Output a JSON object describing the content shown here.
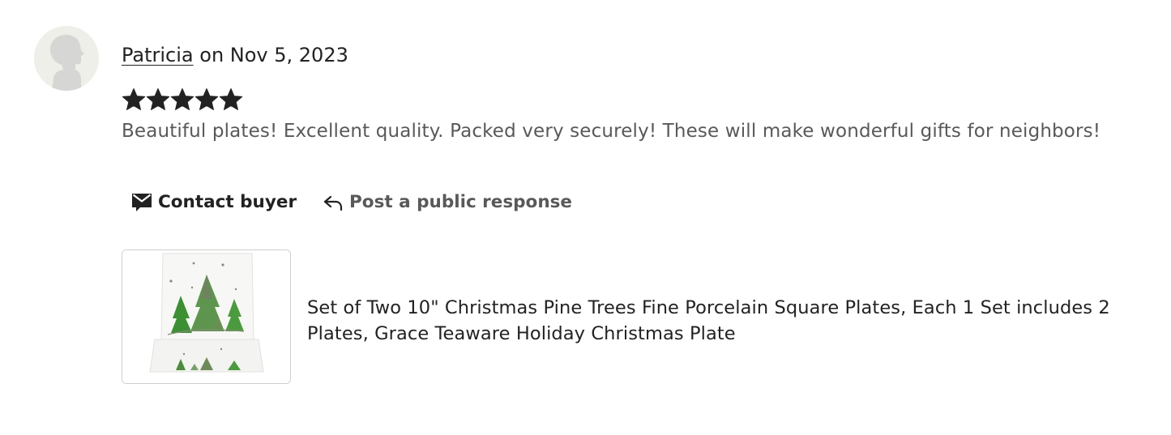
{
  "review": {
    "reviewer_name": "Patricia",
    "date_text": "on Nov 5, 2023",
    "rating": 5,
    "rating_max": 5,
    "body": "Beautiful plates! Excellent quality. Packed very securely! These will make wonderful gifts for neighbors!"
  },
  "actions": {
    "contact_label": "Contact buyer",
    "contact_icon": "envelope-icon",
    "respond_label": "Post a public response",
    "respond_icon": "reply-arrow-icon"
  },
  "listing": {
    "title": "Set of Two 10\" Christmas Pine Trees Fine Porcelain Square Plates, Each 1 Set includes 2 Plates, Grace Teaware Holiday Christmas Plate",
    "thumbnail_icon": "christmas-tree-plate-image"
  },
  "colors": {
    "text_primary": "#222222",
    "text_secondary": "#595959",
    "avatar_bg": "#efefe9",
    "avatar_figure": "#d8d8d8",
    "star": "#222222"
  }
}
